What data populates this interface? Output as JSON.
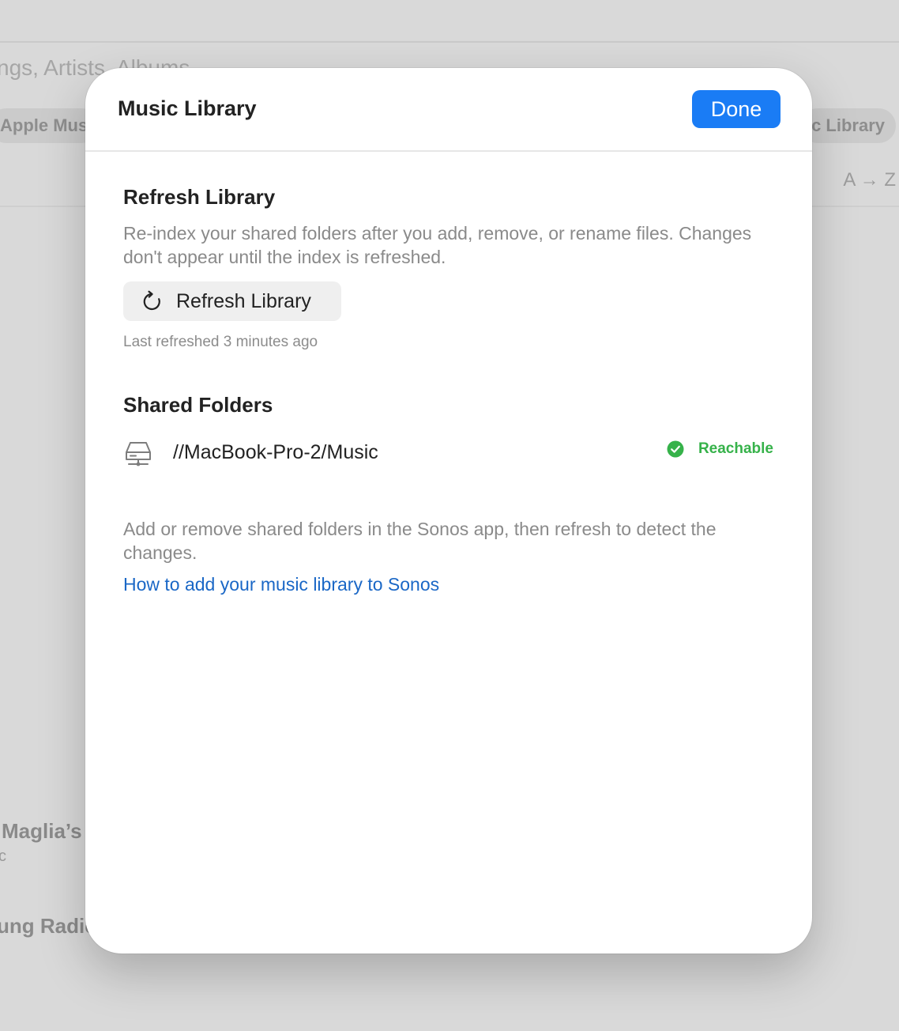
{
  "background": {
    "search_placeholder": "ngs, Artists, Albums",
    "left_pill": "Apple Mus",
    "right_pill": "c Library",
    "sort_label": "A → Z",
    "items": [
      {
        "title": "Maglia’s",
        "subtitle": "c"
      },
      {
        "title": "ung Radic",
        "subtitle": ""
      }
    ]
  },
  "modal": {
    "title": "Music Library",
    "done_label": "Done",
    "refresh": {
      "heading": "Refresh Library",
      "description": "Re-index your shared folders after you add, remove, or rename files. Changes don't appear until the index is refreshed.",
      "button_label": "Refresh Library",
      "button_icon": "refresh-icon",
      "last_refreshed": "Last refreshed 3 minutes ago"
    },
    "shared_folders": {
      "heading": "Shared Folders",
      "folders": [
        {
          "icon": "network-drive-icon",
          "path": "//MacBook-Pro-2/Music",
          "status": "Reachable",
          "status_icon": "checkmark-circle-icon"
        }
      ],
      "note": "Add or remove shared folders in the Sonos app, then refresh to detect the changes.",
      "help_link": "How to add your music library to Sonos"
    }
  },
  "colors": {
    "accent": "#1a7cf5",
    "link": "#1a67c6",
    "success": "#36b24a",
    "secondary_text": "#8a8a8a"
  }
}
